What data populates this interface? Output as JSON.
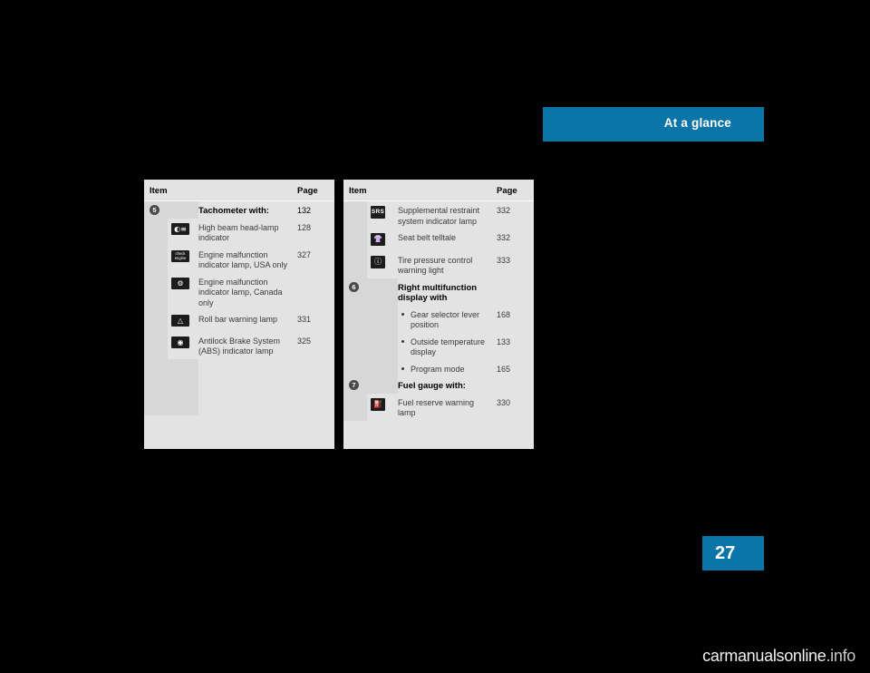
{
  "header": {
    "title": "At a glance"
  },
  "page_number": "27",
  "watermark": {
    "main": "carmanualsonline",
    "suffix": ".info"
  },
  "tables": [
    {
      "id": "left",
      "headers": {
        "item": "Item",
        "page": "Page"
      },
      "rows": [
        {
          "num": "5",
          "icon": "",
          "text": "Tachometer with:",
          "page": "132",
          "bold": true
        },
        {
          "num": "",
          "icon": "high-beam-icon",
          "text": "High beam head-lamp indicator",
          "page": "128",
          "bold": false
        },
        {
          "num": "",
          "icon": "check-engine-icon",
          "text": "Engine malfunction indicator lamp, USA only",
          "page": "327",
          "bold": false
        },
        {
          "num": "",
          "icon": "engine-malfunction-canada-icon",
          "text": "Engine malfunction indicator lamp, Canada only",
          "page": "",
          "bold": false
        },
        {
          "num": "",
          "icon": "roll-bar-icon",
          "text": "Roll bar warning lamp",
          "page": "331",
          "bold": false
        },
        {
          "num": "",
          "icon": "abs-icon",
          "text": "Antilock Brake System (ABS) indicator lamp",
          "page": "325",
          "bold": false
        }
      ]
    },
    {
      "id": "right",
      "headers": {
        "item": "Item",
        "page": "Page"
      },
      "rows": [
        {
          "num": "",
          "icon": "srs-icon",
          "text": "Supplemental restraint system indicator lamp",
          "page": "332",
          "bold": false
        },
        {
          "num": "",
          "icon": "seat-belt-icon",
          "text": "Seat belt telltale",
          "page": "332",
          "bold": false
        },
        {
          "num": "",
          "icon": "tire-pressure-icon",
          "text": "Tire pressure control warning light",
          "page": "333",
          "bold": false
        },
        {
          "num": "6",
          "icon": "",
          "text": "Right multifunction display with",
          "page": "",
          "bold": true
        },
        {
          "num": "",
          "icon": "bullet",
          "text": "Gear selector lever position",
          "page": "168",
          "bold": false
        },
        {
          "num": "",
          "icon": "bullet",
          "text": "Outside temperature display",
          "page": "133",
          "bold": false
        },
        {
          "num": "",
          "icon": "bullet",
          "text": "Program mode",
          "page": "165",
          "bold": false
        },
        {
          "num": "7",
          "icon": "",
          "text": "Fuel gauge with:",
          "page": "",
          "bold": true
        },
        {
          "num": "",
          "icon": "fuel-reserve-icon",
          "text": "Fuel reserve warning lamp",
          "page": "330",
          "bold": false
        }
      ]
    }
  ],
  "icon_labels": {
    "check_engine_line1": "check",
    "check_engine_line2": "engine",
    "srs": "SRS"
  },
  "colors": {
    "accent": "#0c75a8",
    "table_bg": "#e3e3e3",
    "gutter": "#d7d7d7"
  }
}
